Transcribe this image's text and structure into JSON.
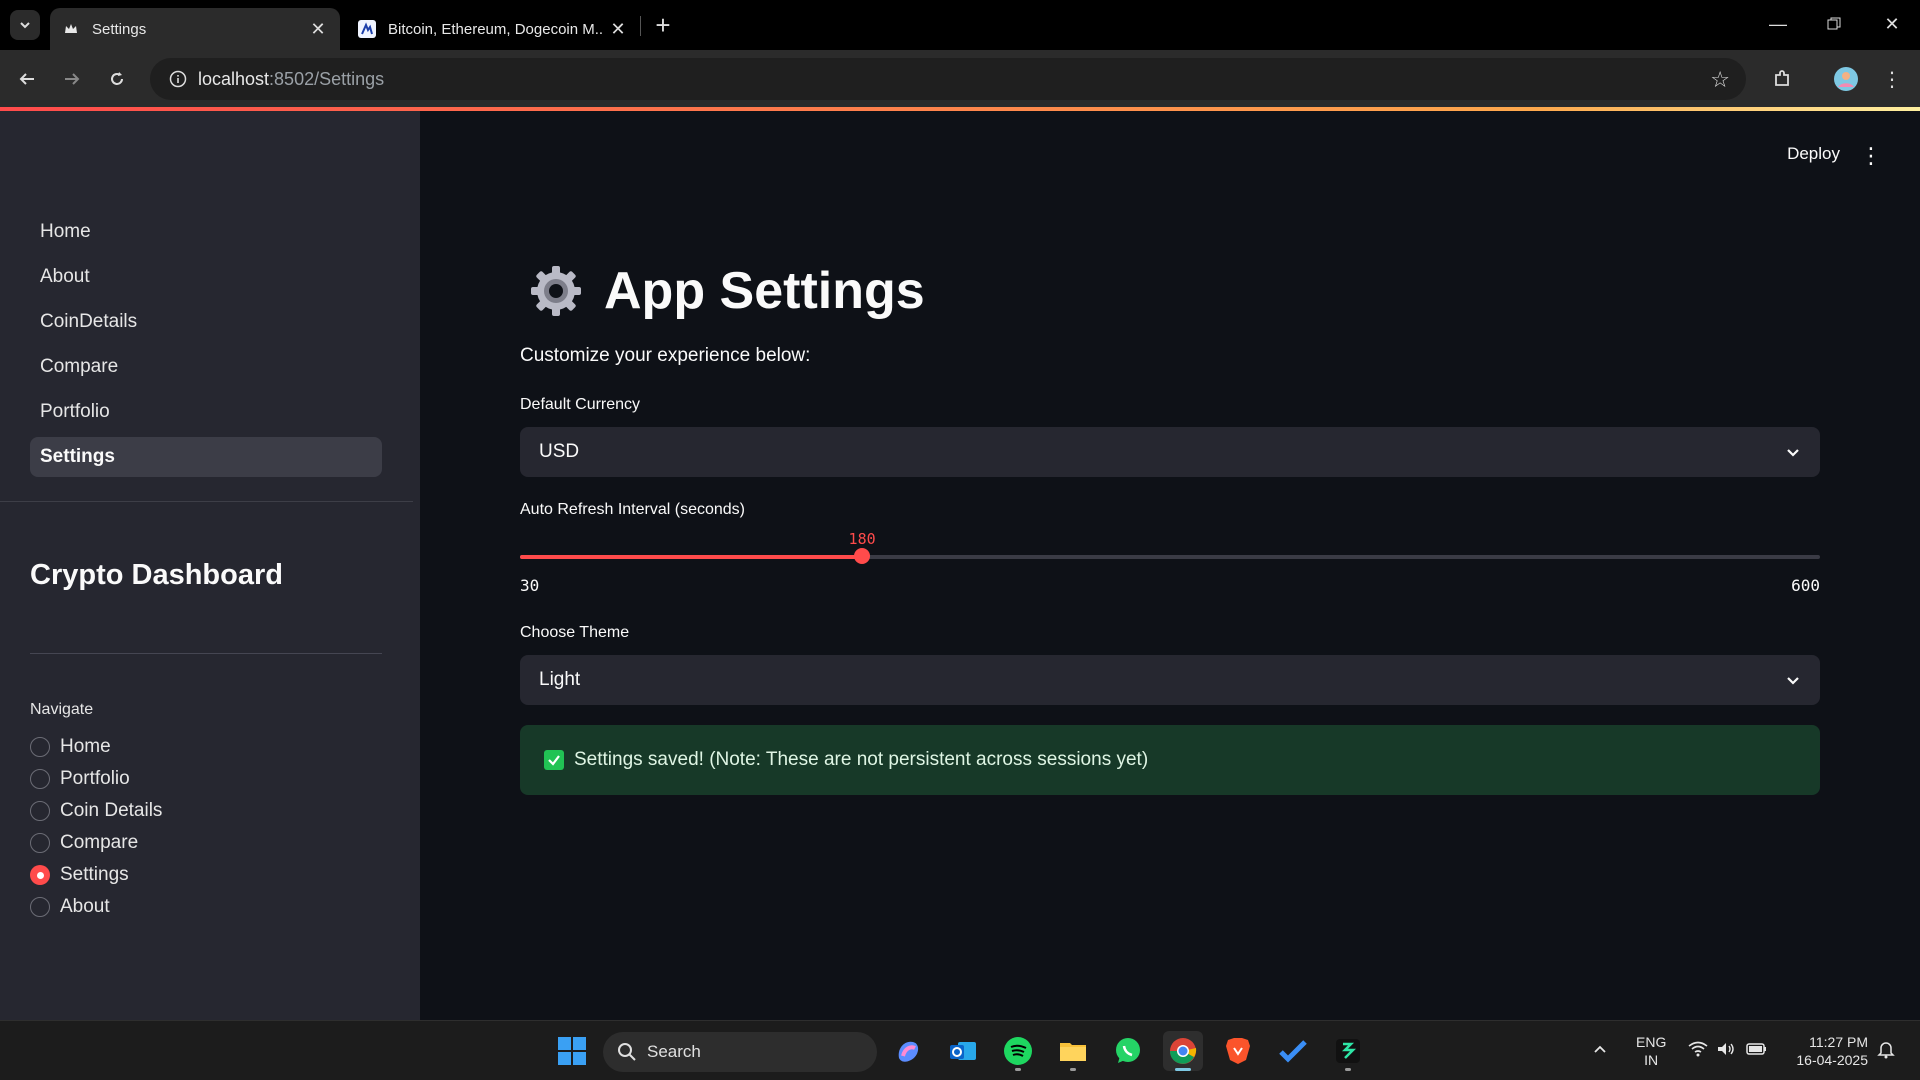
{
  "browser": {
    "tabs": [
      {
        "title": "Settings",
        "active": true
      },
      {
        "title": "Bitcoin, Ethereum, Dogecoin M...",
        "active": false
      }
    ],
    "url_host": "localhost",
    "url_path": ":8502/Settings"
  },
  "sidebar": {
    "pages": [
      {
        "label": "Home",
        "active": false
      },
      {
        "label": "About",
        "active": false
      },
      {
        "label": "CoinDetails",
        "active": false
      },
      {
        "label": "Compare",
        "active": false
      },
      {
        "label": "Portfolio",
        "active": false
      },
      {
        "label": "Settings",
        "active": true
      }
    ],
    "title": "Crypto Dashboard",
    "radio_group_label": "Navigate",
    "radio_options": [
      {
        "label": "Home",
        "selected": false
      },
      {
        "label": "Portfolio",
        "selected": false
      },
      {
        "label": "Coin Details",
        "selected": false
      },
      {
        "label": "Compare",
        "selected": false
      },
      {
        "label": "Settings",
        "selected": true
      },
      {
        "label": "About",
        "selected": false
      }
    ]
  },
  "header": {
    "deploy_label": "Deploy"
  },
  "main": {
    "title": "App Settings",
    "title_icon": "gear-icon",
    "subtitle": "Customize your experience below:",
    "currency": {
      "label": "Default Currency",
      "value": "USD"
    },
    "refresh": {
      "label": "Auto Refresh Interval (seconds)",
      "value": 180,
      "min": 30,
      "max": 600,
      "value_text": "180",
      "min_text": "30",
      "max_text": "600"
    },
    "theme": {
      "label": "Choose Theme",
      "value": "Light"
    },
    "success_message": "Settings saved! (Note: These are not persistent across sessions yet)"
  },
  "taskbar": {
    "search_label": "Search",
    "lang_primary": "ENG",
    "lang_secondary": "IN",
    "time": "11:27 PM",
    "date": "16-04-2025"
  },
  "colors": {
    "accent": "#ff4b4b",
    "sidebar_bg": "#262730",
    "main_bg": "#0e1117",
    "success_bg": "#173928"
  }
}
